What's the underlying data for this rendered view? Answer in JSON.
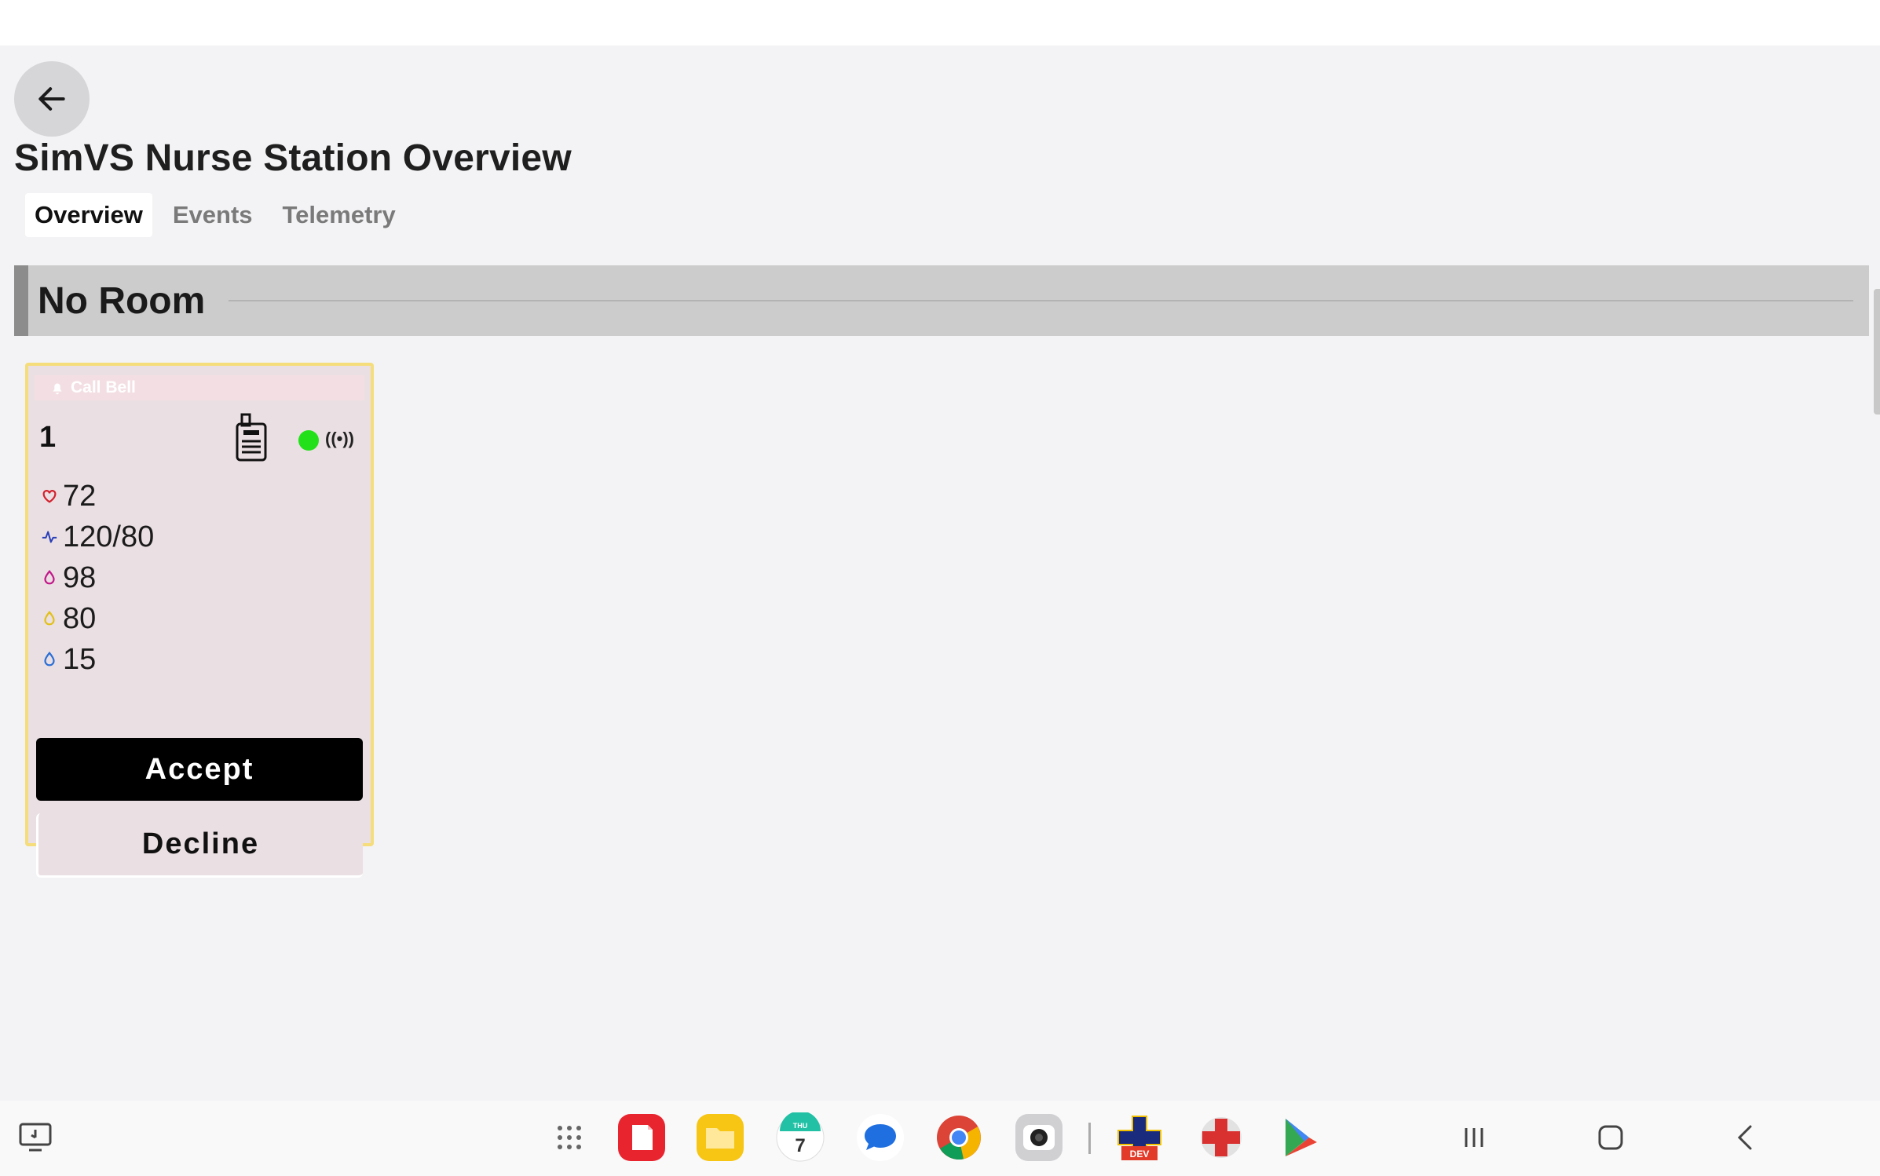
{
  "app": {
    "title": "SimVS Nurse Station Overview",
    "tabs": [
      {
        "label": "Overview",
        "active": true
      },
      {
        "label": "Events",
        "active": false
      },
      {
        "label": "Telemetry",
        "active": false
      }
    ]
  },
  "room": {
    "title": "No Room"
  },
  "patient_card": {
    "banner": "Call Bell",
    "bed_number": "1",
    "status_color": "#22e11a",
    "signal_glyph": "((•))",
    "vitals": [
      {
        "icon": "heart-icon",
        "value": "72"
      },
      {
        "icon": "pulse-wave-icon",
        "value": "120/80"
      },
      {
        "icon": "drop-icon-magenta",
        "value": "98"
      },
      {
        "icon": "drop-icon-yellow",
        "value": "80"
      },
      {
        "icon": "drop-icon-blue",
        "value": "15"
      }
    ],
    "accept_label": "Accept",
    "decline_label": "Decline"
  },
  "taskbar": {
    "calendar_day": "THU",
    "calendar_date": "7",
    "apps": [
      "recent-screen-icon",
      "app-drawer-icon",
      "notes-app-icon",
      "files-app-icon",
      "calendar-app-icon",
      "messages-app-icon",
      "chrome-app-icon",
      "camera-app-icon",
      "simvs-dev-app-icon",
      "simvs-app-icon",
      "play-store-icon"
    ],
    "nav": [
      "recents-nav-icon",
      "home-nav-icon",
      "back-nav-icon"
    ]
  },
  "colors": {
    "accent_card_border": "#f5dd7c",
    "card_background": "#eadfe2",
    "room_header": "#cccccc"
  }
}
